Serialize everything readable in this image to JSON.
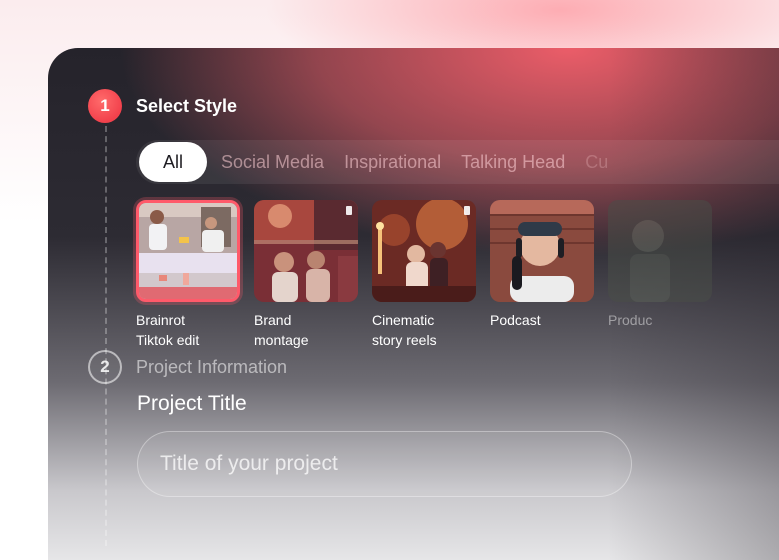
{
  "steps": [
    {
      "number": "1",
      "label": "Select Style"
    },
    {
      "number": "2",
      "label": "Project Information"
    }
  ],
  "filters": [
    "All",
    "Social Media",
    "Inspirational",
    "Talking Head",
    "Cu"
  ],
  "selected_filter": "All",
  "styles": [
    {
      "label": "Brainrot\nTiktok edit",
      "selected": true,
      "icon": "brainrot-thumbnail"
    },
    {
      "label": "Brand\nmontage",
      "selected": false,
      "icon": "brand-montage-thumbnail"
    },
    {
      "label": "Cinematic\nstory reels",
      "selected": false,
      "icon": "cinematic-thumbnail"
    },
    {
      "label": "Podcast",
      "selected": false,
      "icon": "podcast-thumbnail"
    },
    {
      "label": "Produc",
      "selected": false,
      "icon": "product-thumbnail"
    }
  ],
  "project": {
    "title_label": "Project Title",
    "title_placeholder": "Title of your project"
  },
  "colors": {
    "accent": "#f2414c",
    "panel_dark": "#25232b",
    "glow": "#f6606c"
  }
}
